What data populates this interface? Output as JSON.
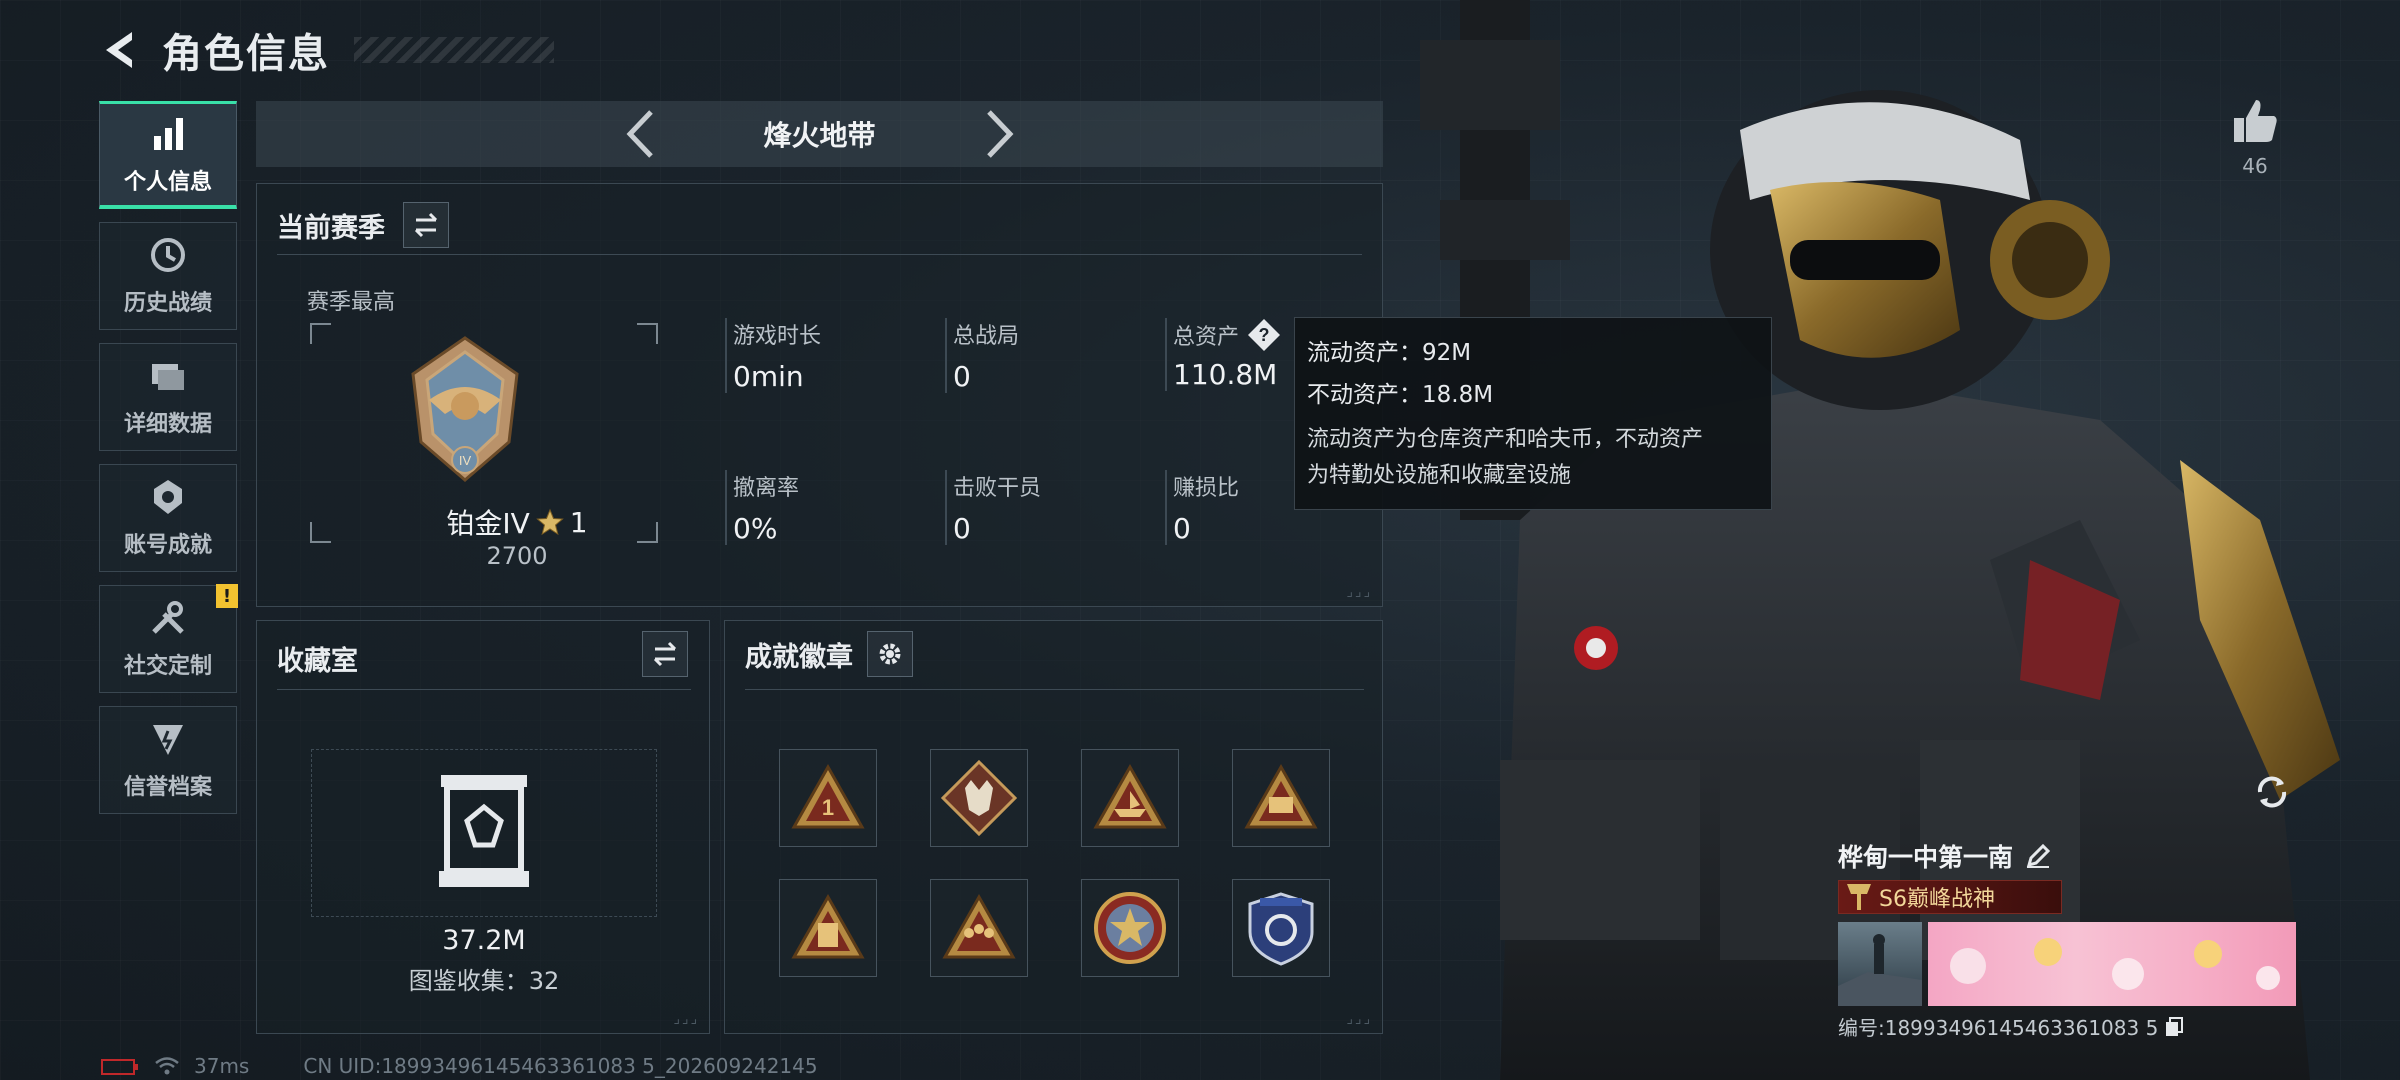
{
  "header": {
    "title": "角色信息"
  },
  "nav": {
    "items": [
      {
        "label": "个人信息",
        "icon": "bar-chart-icon",
        "active": true
      },
      {
        "label": "历史战绩",
        "icon": "history-icon",
        "active": false
      },
      {
        "label": "详细数据",
        "icon": "folders-icon",
        "active": false
      },
      {
        "label": "账号成就",
        "icon": "achievement-icon",
        "active": false
      },
      {
        "label": "社交定制",
        "icon": "tools-icon",
        "active": false,
        "alert": "!"
      },
      {
        "label": "信誉档案",
        "icon": "credit-icon",
        "active": false
      }
    ]
  },
  "mode": {
    "name": "烽火地带"
  },
  "season": {
    "title": "当前赛季",
    "best_label": "赛季最高",
    "rank_name": "铂金IV",
    "rank_stars": "1",
    "rank_score": "2700",
    "stats": [
      {
        "label": "游戏时长",
        "value": "0min"
      },
      {
        "label": "总战局",
        "value": "0"
      },
      {
        "label": "总资产",
        "value": "110.8M"
      },
      {
        "label": "撤离率",
        "value": "0%"
      },
      {
        "label": "击败干员",
        "value": "0"
      },
      {
        "label": "赚损比",
        "value": "0"
      }
    ]
  },
  "tooltip": {
    "liquid": "流动资产：92M",
    "fixed": "不动资产：18.8M",
    "desc_line1": "流动资产为仓库资产和哈夫币，不动资产",
    "desc_line2": "为特勤处设施和收藏室设施"
  },
  "collection": {
    "title": "收藏室",
    "value": "37.2M",
    "count_text": "图鉴收集：32"
  },
  "achievements": {
    "title": "成就徽章",
    "badges": [
      "badge-1",
      "badge-2",
      "badge-3",
      "badge-4",
      "badge-5",
      "badge-6",
      "badge-7",
      "badge-8"
    ]
  },
  "likes": {
    "count": "46"
  },
  "player": {
    "name": "桦甸一中第一南",
    "title_badge": "S6巅峰战神",
    "id_text": "编号:18993496145463361083 5"
  },
  "footer": {
    "ping": "37ms",
    "uid": "CN UID:18993496145463361083 5_202609242145"
  },
  "colors": {
    "accent": "#39e0a8",
    "alert": "#f2c230"
  }
}
